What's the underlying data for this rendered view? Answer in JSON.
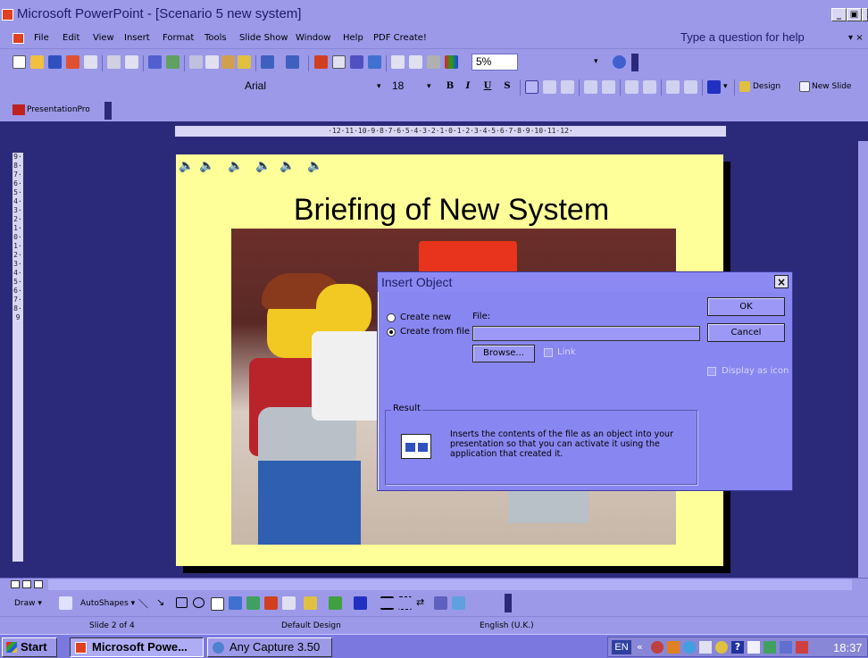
{
  "window": {
    "title": "Microsoft PowerPoint - [Scenario 5 new system]",
    "controls": [
      "_",
      "▣",
      "×"
    ]
  },
  "menubar": {
    "items": [
      "File",
      "Edit",
      "View",
      "Insert",
      "Format",
      "Tools",
      "Slide Show",
      "Window",
      "Help",
      "PDF Create!"
    ],
    "help_placeholder": "Type a question for help",
    "help_arrow": "▾ ×"
  },
  "standard_toolbar": {
    "zoom": "5%",
    "icons": [
      "new-icon",
      "open-icon",
      "save-icon",
      "permission-icon",
      "email-icon",
      "print-icon",
      "print-preview-icon",
      "spelling-icon",
      "research-icon",
      "cut-icon",
      "copy-icon",
      "paste-icon",
      "format-painter-icon",
      "undo-icon",
      "redo-icon",
      "insert-chart-icon",
      "insert-table-icon",
      "tables-borders-icon",
      "insert-hyperlink-icon",
      "expand-all-icon",
      "show-formatting-icon",
      "grayscale-icon",
      "color-icon"
    ]
  },
  "formatting_toolbar": {
    "font": "Arial",
    "size": "18",
    "bold": "B",
    "italic": "I",
    "underline": "U",
    "shadow": "S",
    "design_label": "Design",
    "new_slide_label": "New Slide"
  },
  "presentationpro": {
    "label": "PresentationPro"
  },
  "ruler": {
    "horizontal": "·12·11·10·9·8·7·6·5·4·3·2·1·0·1·2·3·4·5·6·7·8·9·10·11·12·",
    "vertical": "9·8·7·6·5·4·3·2·1·0·1·2·3·4·5·6·7·8·9"
  },
  "slide": {
    "title": "Briefing of New System",
    "sound_icons": 6
  },
  "dialog": {
    "title": "Insert Object",
    "create_new": "Create new",
    "create_from_file": "Create from file",
    "file_label": "File:",
    "file_value": "",
    "browse": "Browse...",
    "link": "Link",
    "ok": "OK",
    "cancel": "Cancel",
    "display_as_icon": "Display as icon",
    "result_label": "Result",
    "result_text": "Inserts the contents of the file as an object into your presentation so that you can activate it using the application that created it."
  },
  "drawing_toolbar": {
    "draw": "Draw ▾",
    "autoshapes": "AutoShapes ▾"
  },
  "statusbar": {
    "slide": "Slide 2 of 4",
    "design": "Default Design",
    "language": "English (U.K.)"
  },
  "taskbar": {
    "start": "Start",
    "tasks": [
      "Microsoft Powe...",
      "Any Capture 3.50"
    ],
    "lang": "EN",
    "tray_arrow": "«",
    "clock": "18:37"
  },
  "colors": {
    "chrome": "#9b99e8",
    "workspace": "#2b2a7a",
    "slide": "#ffff99",
    "dialog": "#8886f0"
  }
}
